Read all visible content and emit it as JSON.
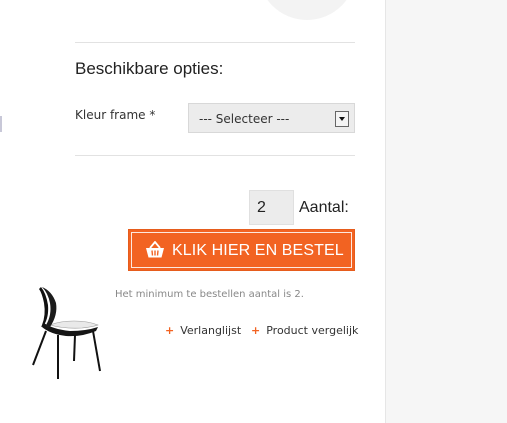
{
  "options": {
    "title": "Beschikbare opties:",
    "frame_color_label": "Kleur frame *",
    "select_value": "--- Selecteer ---"
  },
  "quantity": {
    "value": "2",
    "label": "Aantal:"
  },
  "order_button": {
    "label": "KLIK HIER EN BESTEL"
  },
  "minimum_notice": "Het minimum te bestellen aantal is 2.",
  "links": {
    "wishlist": "Verlanglijst",
    "compare": "Product vergelijk"
  },
  "colors": {
    "accent": "#f26322",
    "field_bg": "#ececec"
  },
  "icons": {
    "order": "basket-icon",
    "select": "chevron-down-icon",
    "add": "plus-icon"
  }
}
